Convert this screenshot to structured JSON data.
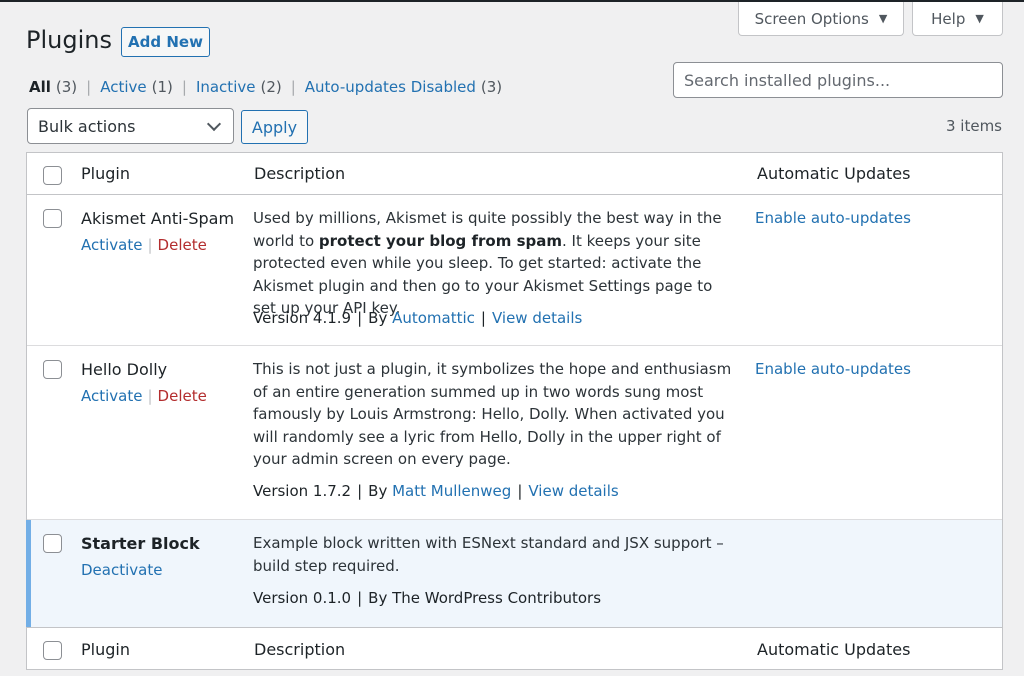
{
  "screen_meta": {
    "screen_options_label": "Screen Options",
    "help_label": "Help",
    "caret": "▼"
  },
  "header": {
    "title": "Plugins",
    "add_new_label": "Add New"
  },
  "filters": [
    {
      "label": "All",
      "count": "(3)",
      "current": true
    },
    {
      "label": "Active",
      "count": "(1)",
      "current": false
    },
    {
      "label": "Inactive",
      "count": "(2)",
      "current": false
    },
    {
      "label": "Auto-updates Disabled",
      "count": "(3)",
      "current": false
    }
  ],
  "filter_separator": "|",
  "search": {
    "placeholder": "Search installed plugins..."
  },
  "bulk": {
    "selected": "Bulk actions",
    "apply_label": "Apply",
    "items_count": "3 items"
  },
  "table": {
    "columns": {
      "plugin": "Plugin",
      "description": "Description",
      "auto_updates": "Automatic Updates"
    }
  },
  "plugins": [
    {
      "name": "Akismet Anti-Spam",
      "active": false,
      "action_primary": "Activate",
      "action_delete": "Delete",
      "desc_before": "Used by millions, Akismet is quite possibly the best way in the world to ",
      "desc_bold": "protect your blog from spam",
      "desc_after": ". It keeps your site protected even while you sleep. To get started: activate the Akismet plugin and then go to your Akismet Settings page to set up your API key.",
      "version": "Version 4.1.9",
      "by_label": "By",
      "author": "Automattic",
      "view_details": "View details",
      "auto_update_link": "Enable auto-updates"
    },
    {
      "name": "Hello Dolly",
      "active": false,
      "action_primary": "Activate",
      "action_delete": "Delete",
      "desc_before": "This is not just a plugin, it symbolizes the hope and enthusiasm of an entire generation summed up in two words sung most famously by Louis Armstrong: Hello, Dolly. When activated you will randomly see a lyric from Hello, Dolly in the upper right of your admin screen on every page.",
      "desc_bold": "",
      "desc_after": "",
      "version": "Version 1.7.2",
      "by_label": "By",
      "author": "Matt Mullenweg",
      "view_details": "View details",
      "auto_update_link": "Enable auto-updates"
    },
    {
      "name": "Starter Block",
      "active": true,
      "action_primary": "Deactivate",
      "desc_before": "Example block written with ESNext standard and JSX support – build step required.",
      "desc_bold": "",
      "desc_after": "",
      "version": "Version 0.1.0",
      "by_label": "By",
      "author_plain": "The WordPress Contributors"
    }
  ],
  "colors": {
    "link": "#2271b1",
    "delete": "#b32d2e",
    "active_row_bg": "#f0f6fc",
    "active_row_border": "#72aee6"
  }
}
